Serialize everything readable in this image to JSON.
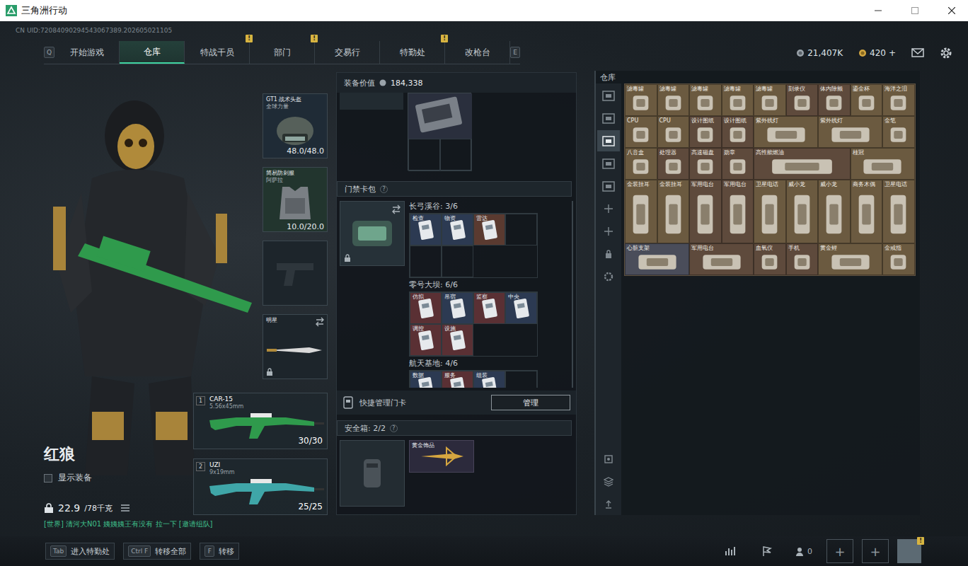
{
  "window": {
    "title": "三角洲行动"
  },
  "uid": "CN UID:72084090294543067389.202605021105",
  "nav": {
    "left_key": "Q",
    "right_key": "E",
    "tabs": [
      {
        "label": "开始游戏",
        "selected": false,
        "badge": ""
      },
      {
        "label": "仓库",
        "selected": true,
        "badge": ""
      },
      {
        "label": "特战干员",
        "selected": false,
        "badge": "!"
      },
      {
        "label": "部门",
        "selected": false,
        "badge": "!"
      },
      {
        "label": "交易行",
        "selected": false,
        "badge": ""
      },
      {
        "label": "特勤处",
        "selected": false,
        "badge": "!"
      },
      {
        "label": "改枪台",
        "selected": false,
        "badge": ""
      }
    ]
  },
  "currency": {
    "coins": "21,407K",
    "tickets": "420",
    "add": "+"
  },
  "equipment": [
    {
      "kind": "helmet",
      "name": "GT1 战术头盔",
      "sub": "全球力量",
      "durability": "48.0/48.0",
      "color": "#1f2b36"
    },
    {
      "kind": "armor",
      "name": "简易防刺服",
      "sub": "阿萨拉",
      "durability": "10.0/20.0",
      "color": "#22352e"
    },
    {
      "kind": "pistol",
      "name": "",
      "sub": "",
      "durability": "",
      "color": "#1d252b"
    },
    {
      "kind": "melee",
      "name": "明星",
      "sub": "",
      "durability": "",
      "color": "#1d252b"
    }
  ],
  "weapons": [
    {
      "slot": "1",
      "name": "CAR-15",
      "caliber": "5.56x45mm",
      "ammo": "30/30",
      "color": "#2f9a4c"
    },
    {
      "slot": "2",
      "name": "UZI",
      "caliber": "9x19mm",
      "ammo": "25/25",
      "color": "#3fa6a8"
    }
  ],
  "character": {
    "name": "红狼",
    "show_equipment": {
      "label": "显示装备",
      "checked": false
    },
    "weight": "22.9",
    "weight_max": "/78千克"
  },
  "chat": "[世界] 清河大N01  姨姨姨王有没有 拉一下 [邀请组队]",
  "hotkeys": [
    {
      "key": "Tab",
      "label": "进入特勤处"
    },
    {
      "key": "Ctrl F",
      "label": "转移全部"
    },
    {
      "key": "F",
      "label": "转移"
    }
  ],
  "loadout": {
    "value_label": "装备价值",
    "value": "184,338",
    "keycard_title": "门禁卡包",
    "help": "?",
    "maps": [
      {
        "title": "长弓溪谷: 3/6",
        "slots": 6,
        "cards": [
          {
            "label": "检查",
            "color": "#2c3a52"
          },
          {
            "label": "物资",
            "color": "#2c3a52"
          },
          {
            "label": "雷达",
            "color": "#5a3a30"
          }
        ]
      },
      {
        "title": "零号大坝: 6/6",
        "slots": 6,
        "cards": [
          {
            "label": "仿拟",
            "color": "#5a3034"
          },
          {
            "label": "吊宿",
            "color": "#2c3a52"
          },
          {
            "label": "监察",
            "color": "#5a3034"
          },
          {
            "label": "中央",
            "color": "#2c3a52"
          },
          {
            "label": "调控",
            "color": "#5a3034"
          },
          {
            "label": "设施",
            "color": "#5a3034"
          }
        ]
      },
      {
        "title": "航天基地: 4/6",
        "slots": 6,
        "cards": [
          {
            "label": "数据",
            "color": "#2c3a52"
          },
          {
            "label": "服务",
            "color": "#5a3034"
          },
          {
            "label": "组装",
            "color": "#2c3a52"
          }
        ]
      }
    ],
    "manage_label": "快捷管理门卡",
    "manage_button": "管理",
    "safe": {
      "title": "安全箱: 2/2",
      "help": "?",
      "items": [
        {
          "label": "黄金饰品"
        }
      ]
    }
  },
  "warehouse": {
    "title": "仓库",
    "tabs": [
      {
        "selected": false
      },
      {
        "selected": false
      },
      {
        "selected": true
      },
      {
        "selected": false
      },
      {
        "selected": false
      }
    ],
    "items": [
      {
        "label": "滤毒罐",
        "cols": 1,
        "rows": 1,
        "color": "#6b5a40"
      },
      {
        "label": "滤毒罐",
        "cols": 1,
        "rows": 1,
        "color": "#6b5a40"
      },
      {
        "label": "滤毒罐",
        "cols": 1,
        "rows": 1,
        "color": "#6b5a40"
      },
      {
        "label": "滤毒罐",
        "cols": 1,
        "rows": 1,
        "color": "#6b5a40"
      },
      {
        "label": "滤毒罐",
        "cols": 1,
        "rows": 1,
        "color": "#6b5a40"
      },
      {
        "label": "刻录仪",
        "cols": 1,
        "rows": 1,
        "color": "#5e4a3c"
      },
      {
        "label": "体内除颤",
        "cols": 1,
        "rows": 1,
        "color": "#5e4a3c"
      },
      {
        "label": "鎏金杯",
        "cols": 1,
        "rows": 1,
        "color": "#6b5a40"
      },
      {
        "label": "海洋之泪",
        "cols": 1,
        "rows": 1,
        "color": "#6b5a40"
      },
      {
        "label": "CPU",
        "cols": 1,
        "rows": 1,
        "color": "#6b5a40"
      },
      {
        "label": "CPU",
        "cols": 1,
        "rows": 1,
        "color": "#6b5a40"
      },
      {
        "label": "设计图纸",
        "cols": 1,
        "rows": 1,
        "color": "#5e4a3c"
      },
      {
        "label": "设计图纸",
        "cols": 1,
        "rows": 1,
        "color": "#5e4a3c"
      },
      {
        "label": "紫外线灯",
        "cols": 2,
        "rows": 1,
        "color": "#6b5a40"
      },
      {
        "label": "紫外线灯",
        "cols": 2,
        "rows": 1,
        "color": "#6b5a40"
      },
      {
        "label": "金笔",
        "cols": 1,
        "rows": 1,
        "color": "#6b5a40"
      },
      {
        "label": "八音盒",
        "cols": 1,
        "rows": 1,
        "color": "#6b5a40"
      },
      {
        "label": "处理器",
        "cols": 1,
        "rows": 1,
        "color": "#5e4a3c"
      },
      {
        "label": "高速磁盘",
        "cols": 1,
        "rows": 1,
        "color": "#5e4a3c"
      },
      {
        "label": "勋章",
        "cols": 1,
        "rows": 1,
        "color": "#5e4a3c"
      },
      {
        "label": "高性能燃油",
        "cols": 3,
        "rows": 1,
        "color": "#5e4a3c"
      },
      {
        "label": "桂冠",
        "cols": 2,
        "rows": 1,
        "color": "#6b5a40"
      },
      {
        "label": "金装挂耳",
        "cols": 1,
        "rows": 2,
        "color": "#6b5a40"
      },
      {
        "label": "金装挂耳",
        "cols": 1,
        "rows": 2,
        "color": "#6b5a40"
      },
      {
        "label": "军用电台",
        "cols": 1,
        "rows": 2,
        "color": "#5e4a3c"
      },
      {
        "label": "军用电台",
        "cols": 1,
        "rows": 2,
        "color": "#5e4a3c"
      },
      {
        "label": "卫星电话",
        "cols": 1,
        "rows": 2,
        "color": "#6b5a40"
      },
      {
        "label": "威小龙",
        "cols": 1,
        "rows": 2,
        "color": "#6b5a40"
      },
      {
        "label": "威小龙",
        "cols": 1,
        "rows": 2,
        "color": "#6b5a40"
      },
      {
        "label": "商务木偶",
        "cols": 1,
        "rows": 2,
        "color": "#6b5a40"
      },
      {
        "label": "卫星电话",
        "cols": 1,
        "rows": 2,
        "color": "#6b5a40"
      },
      {
        "label": "心脏支架",
        "cols": 2,
        "rows": 1,
        "color": "#4a4d5a"
      },
      {
        "label": "军用电台",
        "cols": 2,
        "rows": 1,
        "color": "#5e4a3c"
      },
      {
        "label": "血氧仪",
        "cols": 1,
        "rows": 1,
        "color": "#5e4a3c"
      },
      {
        "label": "手机",
        "cols": 1,
        "rows": 1,
        "color": "#5e4a3c"
      },
      {
        "label": "黄金鲤",
        "cols": 2,
        "rows": 1,
        "color": "#6b5a40"
      },
      {
        "label": "金戒指",
        "cols": 1,
        "rows": 1,
        "color": "#6b5a40"
      }
    ]
  },
  "bottom": {
    "friends": "0",
    "slot_add": "+",
    "avatar_badge": "!"
  }
}
